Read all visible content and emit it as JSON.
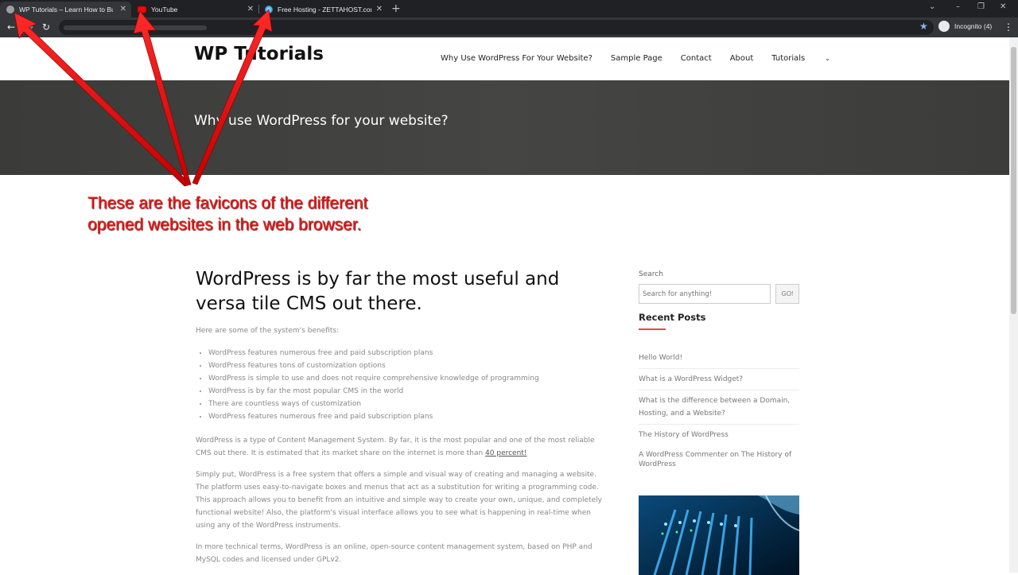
{
  "browser": {
    "tabs": [
      {
        "title": "WP Tutorials – Learn How to Buil",
        "favicon": "wordpress-favicon",
        "active": true
      },
      {
        "title": "YouTube",
        "favicon": "youtube-favicon",
        "active": false
      },
      {
        "title": "Free Hosting - ZETTAHOST.com",
        "favicon": "zettahost-favicon",
        "active": false
      }
    ],
    "incognito_label": "Incognito (4)"
  },
  "site": {
    "title": "WP Tutorials",
    "nav": [
      "Why Use WordPress For Your Website?",
      "Sample Page",
      "Contact",
      "About",
      "Tutorials"
    ],
    "hero_title": "Why use WordPress for your website?"
  },
  "annotation": {
    "text": "These are the favicons of the different opened websites in the web browser.",
    "color": "#e31e1e"
  },
  "article": {
    "heading": "WordPress is by far the most useful and versa tile CMS out there.",
    "intro": "Here are some of the system's benefits:",
    "benefits": [
      "WordPress features numerous free and paid subscription plans",
      "WordPress features tons of customization options",
      "WordPress is simple to use and does not require comprehensive knowledge of programming",
      "WordPress is by far the most popular CMS in the world",
      "There are countless ways of customization",
      "WordPress features numerous free and paid subscription plans"
    ],
    "para1_text": "WordPress is a type of Content Management System.  By far, it is the most popular and one of the most reliable CMS out there. It is estimated that its market share on the internet is more than ",
    "para1_link": "40 percent!",
    "para2": "Simply put, WordPress is a free system that offers a simple and visual way of creating and managing a website. The platform uses easy-to-navigate boxes and menus that act as a substitution for writing a programming code. This approach allows you to benefit from an intuitive and simple way to create your own, unique, and completely functional website! Also, the platform's visual interface allows you to see what is happening in real-time when using any of the WordPress instruments.",
    "para3": "In more technical terms, WordPress is an online, open-source content management system, based on PHP and MySQL codes and licensed under GPLv2."
  },
  "sidebar": {
    "search_label": "Search",
    "search_placeholder": "Search for anything!",
    "go_label": "GO!",
    "recent_title": "Recent Posts",
    "posts": [
      "Hello World!",
      "What is a WordPress Widget?",
      "What is the difference between a Domain, Hosting, and a Website?",
      "The History of WordPress"
    ],
    "comment": "A WordPress Commenter on The History of WordPress"
  },
  "colors": {
    "accent_red": "#e74c3c",
    "hero_bg": "#40403e",
    "chrome_dark": "#202124"
  }
}
